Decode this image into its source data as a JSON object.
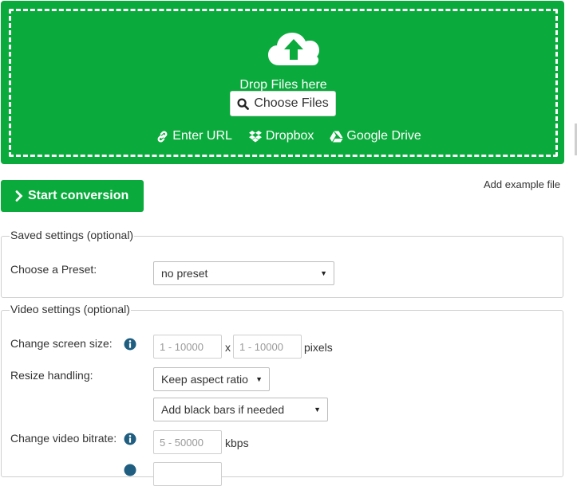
{
  "dropzone": {
    "drop_text": "Drop Files here",
    "choose_label": "Choose Files",
    "sources": {
      "url": "Enter URL",
      "dropbox": "Dropbox",
      "gdrive": "Google Drive"
    }
  },
  "actions": {
    "start_label": "Start conversion",
    "example_label": "Add example file"
  },
  "saved_settings": {
    "legend": "Saved settings (optional)",
    "preset_label": "Choose a Preset:",
    "preset_value": "no preset"
  },
  "video_settings": {
    "legend": "Video settings (optional)",
    "screen_size_label": "Change screen size:",
    "width_placeholder": "1 - 10000",
    "height_placeholder": "1 - 10000",
    "size_separator": "x",
    "size_unit": "pixels",
    "resize_label": "Resize handling:",
    "resize_value": "Keep aspect ratio",
    "bars_value": "Add black bars if needed",
    "bitrate_label": "Change video bitrate:",
    "bitrate_placeholder": "5 - 50000",
    "bitrate_unit": "kbps"
  },
  "colors": {
    "accent": "#0aab3c",
    "info_icon": "#1f5e80"
  }
}
